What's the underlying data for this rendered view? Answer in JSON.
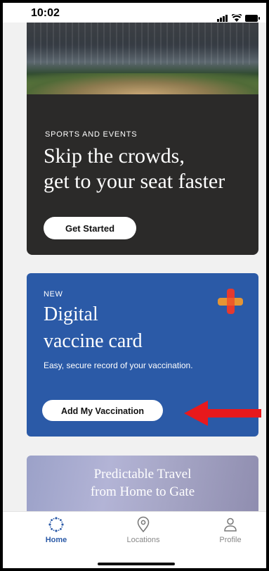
{
  "status_bar": {
    "time": "10:02"
  },
  "cards": {
    "sports": {
      "eyebrow": "SPORTS AND EVENTS",
      "title_line1": "Skip the crowds,",
      "title_line2": "get to your seat faster",
      "button_label": "Get Started"
    },
    "vaccine": {
      "eyebrow": "NEW",
      "title_line1": "Digital",
      "title_line2": "vaccine card",
      "subtitle": "Easy, secure record of your vaccination.",
      "button_label": "Add My Vaccination",
      "icon": "plus-cross-icon",
      "icon_colors": [
        "#e53a2f",
        "#f59a2a"
      ]
    },
    "travel": {
      "title_line1": "Predictable Travel",
      "title_line2": "from Home to Gate"
    }
  },
  "annotation": {
    "arrow_color": "#e8191c"
  },
  "tab_bar": {
    "active_color": "#2b5aa7",
    "tabs": [
      {
        "label": "Home",
        "icon": "home-sparkle-icon",
        "active": true
      },
      {
        "label": "Locations",
        "icon": "location-pin-icon",
        "active": false
      },
      {
        "label": "Profile",
        "icon": "user-icon",
        "active": false
      }
    ]
  }
}
